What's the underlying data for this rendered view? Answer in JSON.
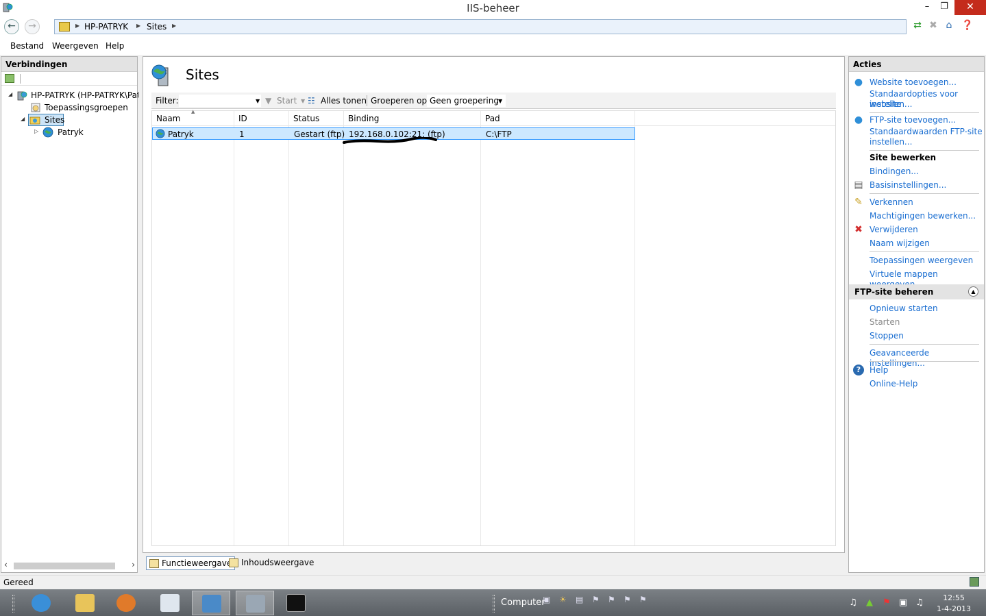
{
  "window": {
    "title": "IIS-beheer"
  },
  "address": {
    "crumbs": [
      "HP-PATRYK",
      "Sites"
    ]
  },
  "menu": {
    "items": [
      "Bestand",
      "Weergeven",
      "Help"
    ]
  },
  "connections": {
    "header": "Verbindingen",
    "tree": {
      "server": "HP-PATRYK (HP-PATRYK\\Pat",
      "app_pools": "Toepassingsgroepen",
      "sites": "Sites",
      "site": "Patryk"
    }
  },
  "main": {
    "title": "Sites",
    "filter_label": "Filter:",
    "start_label": "Start",
    "show_all_label": "Alles tonen",
    "group_label": "Groeperen op:",
    "group_value": "Geen groepering",
    "columns": [
      "Naam",
      "ID",
      "Status",
      "Binding",
      "Pad"
    ],
    "rows": [
      {
        "name": "Patryk",
        "id": "1",
        "status": "Gestart (ftp)",
        "binding": "192.168.0.102:21: (ftp)",
        "path": "C:\\FTP"
      }
    ]
  },
  "view_tabs": {
    "features": "Functieweergave",
    "content": "Inhoudsweergave"
  },
  "actions": {
    "header": "Acties",
    "add_website": "Website toevoegen...",
    "website_defaults_1": "Standaardopties voor website",
    "website_defaults_2": "instellen...",
    "add_ftp": "FTP-site toevoegen...",
    "ftp_defaults_1": "Standaardwaarden FTP-site",
    "ftp_defaults_2": "instellen...",
    "edit_site": "Site bewerken",
    "bindings": "Bindingen...",
    "basic_settings": "Basisinstellingen...",
    "explore": "Verkennen",
    "edit_permissions": "Machtigingen bewerken...",
    "remove": "Verwijderen",
    "rename": "Naam wijzigen",
    "view_applications": "Toepassingen weergeven",
    "view_virtual_dirs": "Virtuele mappen weergeven",
    "manage_ftp": "FTP-site beheren",
    "restart": "Opnieuw starten",
    "start": "Starten",
    "stop": "Stoppen",
    "advanced": "Geavanceerde instellingen...",
    "help": "Help",
    "online_help": "Online-Help"
  },
  "status": {
    "text": "Gereed"
  },
  "taskbar": {
    "computer_label": "Computer",
    "time": "12:55",
    "date": "1-4-2013"
  },
  "colors": {
    "link": "#1a6ed1",
    "selection": "#cce8ff",
    "close_button": "#c42b1c"
  }
}
